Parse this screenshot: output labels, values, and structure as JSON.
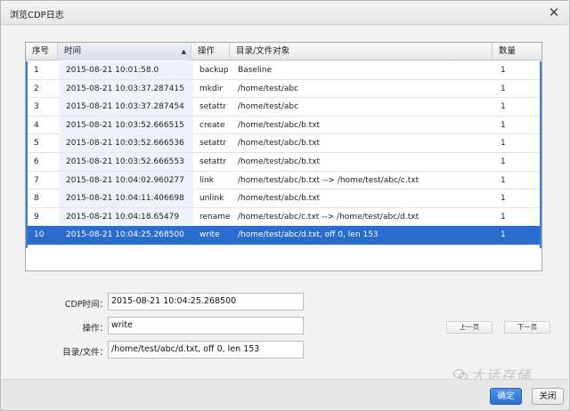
{
  "window": {
    "title": "浏览CDP日志",
    "close_glyph": "✕"
  },
  "table": {
    "headers": {
      "seq": "序号",
      "time": "时间",
      "op": "操作",
      "path": "目录/文件对象",
      "count": "数量"
    },
    "sort_arrow": "▲",
    "rows": [
      {
        "seq": "1",
        "time": "2015-08-21 10:01:58.0",
        "op": "backup",
        "path": "Baseline",
        "count": "1"
      },
      {
        "seq": "2",
        "time": "2015-08-21 10:03:37.287415",
        "op": "mkdir",
        "path": "/home/test/abc",
        "count": "1"
      },
      {
        "seq": "3",
        "time": "2015-08-21 10:03:37.287454",
        "op": "setattr",
        "path": "/home/test/abc",
        "count": "1"
      },
      {
        "seq": "4",
        "time": "2015-08-21 10:03:52.666515",
        "op": "create",
        "path": "/home/test/abc/b.txt",
        "count": "1"
      },
      {
        "seq": "5",
        "time": "2015-08-21 10:03:52.666536",
        "op": "setattr",
        "path": "/home/test/abc/b.txt",
        "count": "1"
      },
      {
        "seq": "6",
        "time": "2015-08-21 10:03:52.666553",
        "op": "setattr",
        "path": "/home/test/abc/b.txt",
        "count": "1"
      },
      {
        "seq": "7",
        "time": "2015-08-21 10:04:02.960277",
        "op": "link",
        "path": "/home/test/abc/b.txt --> /home/test/abc/c.txt",
        "count": "1"
      },
      {
        "seq": "8",
        "time": "2015-08-21 10:04:11.406698",
        "op": "unlink",
        "path": "/home/test/abc/b.txt",
        "count": "1"
      },
      {
        "seq": "9",
        "time": "2015-08-21 10:04:18.65479",
        "op": "rename",
        "path": "/home/test/abc/c.txt --> /home/test/abc/d.txt",
        "count": "1"
      },
      {
        "seq": "10",
        "time": "2015-08-21 10:04:25.268500",
        "op": "write",
        "path": "/home/test/abc/d.txt, off 0, len 153",
        "count": "1"
      }
    ],
    "selected_seq": "10"
  },
  "details": {
    "cdp_time_label": "CDP时间：",
    "cdp_time_value": "2015-08-21 10:04:25.268500",
    "op_label": "操作：",
    "op_value": "write",
    "path_label": "目录/文件：",
    "path_value": "/home/test/abc/d.txt, off 0, len 153"
  },
  "pager": {
    "prev_label": "上一页",
    "next_label": "下一页"
  },
  "footer": {
    "ok_label": "确定",
    "close_label": "关闭"
  },
  "watermark": {
    "text": "大话存储"
  },
  "colors": {
    "selection": "#2a6ccd",
    "accent_border": "#3d7fd6"
  }
}
